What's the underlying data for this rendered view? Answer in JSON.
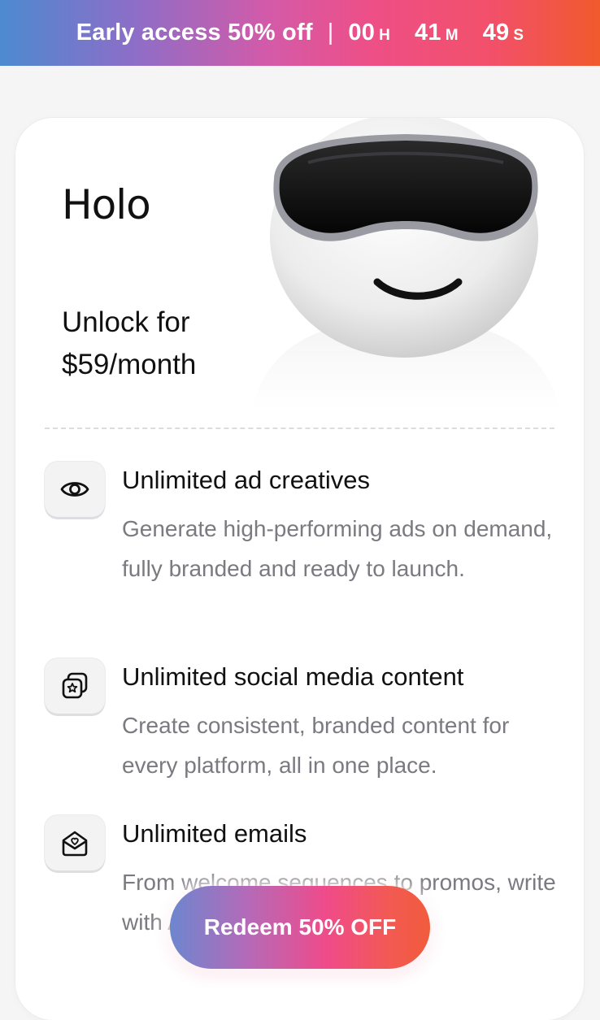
{
  "banner": {
    "text": "Early access 50% off",
    "separator": "|",
    "countdown": [
      {
        "value": "00",
        "unit": "H"
      },
      {
        "value": "41",
        "unit": "M"
      },
      {
        "value": "49",
        "unit": "S"
      }
    ]
  },
  "card": {
    "logo": "Holo",
    "price_line1": "Unlock for",
    "price_line2": "$59/month",
    "features": [
      {
        "icon": "eye-icon",
        "title": "Unlimited ad creatives",
        "description": "Generate high-performing ads on demand, fully branded and ready to launch."
      },
      {
        "icon": "social-stack-icon",
        "title": "Unlimited social media content",
        "description": "Create consistent, branded content for every platform, all in one place."
      },
      {
        "icon": "email-heart-icon",
        "title": "Unlimited emails",
        "description": "From welcome sequences to promos, write with AI starting from scratch."
      }
    ]
  },
  "cta": {
    "label": "Redeem 50% OFF"
  },
  "colors": {
    "banner_start": "#4d8ad0",
    "banner_mid": "#ee4f86",
    "banner_end": "#f05a2c"
  }
}
